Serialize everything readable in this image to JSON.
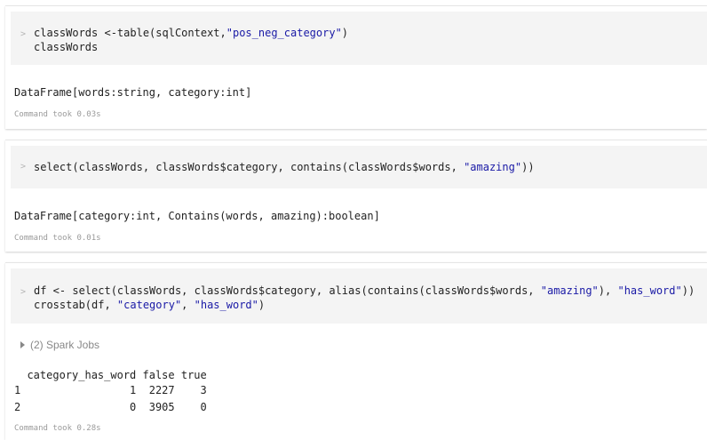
{
  "cell1": {
    "prompt": ">",
    "code_line1": {
      "pre": "classWords <-table(sqlContext,",
      "str": "\"pos_neg_category\"",
      "post": ")"
    },
    "code_line2": "classWords",
    "output": "DataFrame[words:string, category:int]",
    "took": "Command took 0.03s"
  },
  "cell2": {
    "prompt": ">",
    "code_line1": {
      "pre": "select(classWords, classWords$category, contains(classWords$words, ",
      "str": "\"amazing\"",
      "post": "))"
    },
    "output": "DataFrame[category:int, Contains(words, amazing):boolean]",
    "took": "Command took 0.01s"
  },
  "cell3": {
    "prompt": ">",
    "code_line1": {
      "pre": "df <- select(classWords, classWords$category, alias(contains(classWords$words, ",
      "str1": "\"amazing\"",
      "mid": "), ",
      "str2": "\"has_word\"",
      "post": "))"
    },
    "code_line2": {
      "pre": "crosstab(df, ",
      "str1": "\"category\"",
      "mid": ", ",
      "str2": "\"has_word\"",
      "post": ")"
    },
    "spark_jobs": "(2) Spark Jobs",
    "table_header": "  category_has_word false true",
    "table_rows": [
      "1                 1  2227    3",
      "2                 0  3905    0"
    ],
    "took": "Command took 0.28s"
  }
}
